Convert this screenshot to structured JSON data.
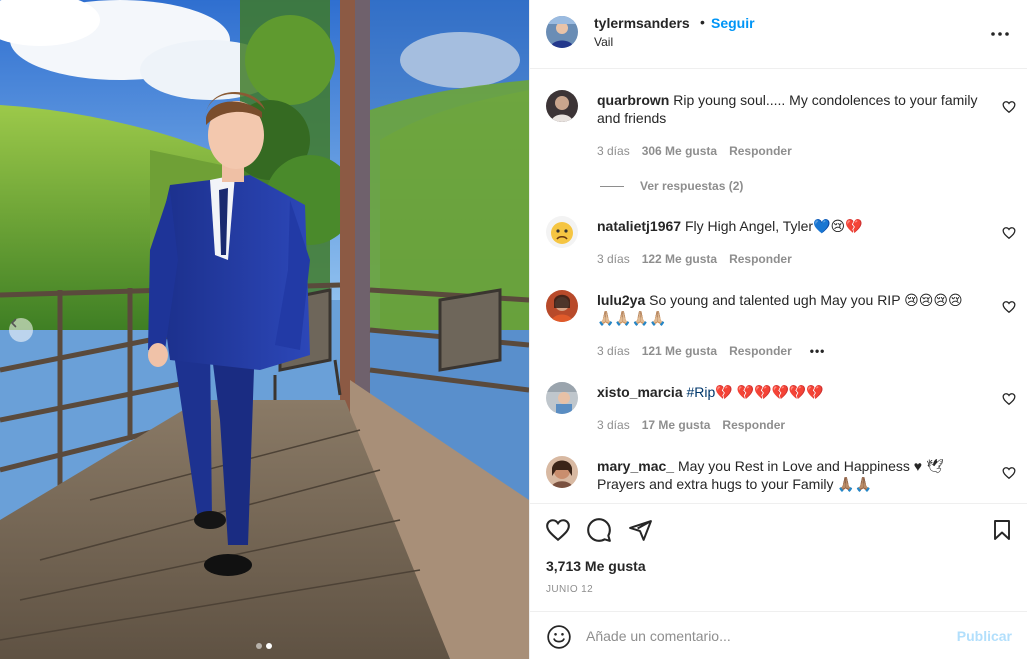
{
  "post": {
    "username": "tylermsanders",
    "separator": "•",
    "follow_label": "Seguir",
    "location": "Vail"
  },
  "comments": [
    {
      "username": "quarbrown",
      "text": "Rip young soul..... My condolences to your family and friends",
      "age": "3 días",
      "likes": "306 Me gusta",
      "reply_label": "Responder",
      "view_replies": "Ver respuestas (2)"
    },
    {
      "username": "natalietj1967",
      "text": "Fly High Angel, Tyler💙😢💔",
      "age": "3 días",
      "likes": "122 Me gusta",
      "reply_label": "Responder"
    },
    {
      "username": "lulu2ya",
      "text": "So young and talented ugh May you RIP 😢😢😢😢 🙏🏼🙏🏼🙏🏼🙏🏼",
      "age": "3 días",
      "likes": "121 Me gusta",
      "reply_label": "Responder",
      "more": "•••"
    },
    {
      "username": "xisto_marcia",
      "hashtag": "#Rip",
      "text": "💔 💔💔💔💔💔",
      "age": "3 días",
      "likes": "17 Me gusta",
      "reply_label": "Responder"
    },
    {
      "username": "mary_mac_",
      "text": "May you Rest in Love and Happiness ♥ 🕊 Prayers and extra hugs to your Family 🙏🏽🙏🏽"
    }
  ],
  "footer": {
    "likes": "3,713 Me gusta",
    "date": "Junio 12",
    "add_comment_placeholder": "Añade un comentario...",
    "publish_label": "Publicar"
  },
  "icons": {
    "like": "heart-icon",
    "comment": "comment-icon",
    "share": "paper-plane-icon",
    "save": "bookmark-icon",
    "more": "more-icon",
    "emoji": "smiley-icon",
    "prev": "chevron-left-icon"
  },
  "colors": {
    "accent": "#0095f6",
    "publish_disabled": "#b2dffc",
    "muted": "#8e8e8e",
    "text": "#262626"
  },
  "carousel": {
    "slides": 2,
    "active_slide": 2
  }
}
